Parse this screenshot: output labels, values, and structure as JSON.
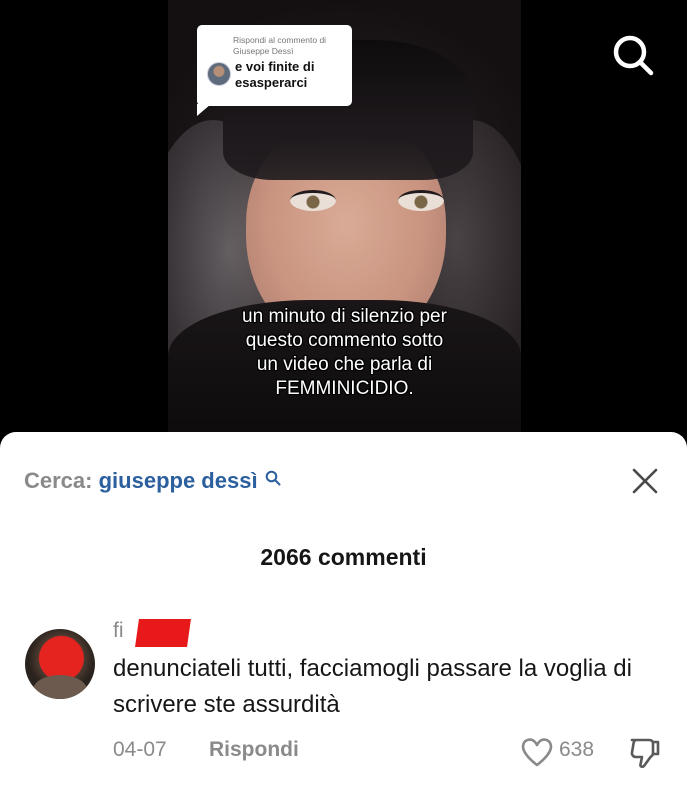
{
  "video": {
    "reply_card": {
      "subtitle": "Rispondi al commento di\nGiuseppe Dessì",
      "text": "e voi finite di\nesasperarci"
    },
    "caption": "un minuto di silenzio per\nquesto commento sotto\nun video che parla di\nFEMMINICIDIO.",
    "search_icon": "search-icon"
  },
  "comments_sheet": {
    "search_label": "Cerca:",
    "search_term": "giuseppe dessì",
    "count_label": "2066 commenti",
    "close_icon": "close-icon",
    "comment": {
      "username_visible": "fi",
      "text": "denunciateli tutti, facciamogli passare la voglia di scrivere ste assurdità",
      "date": "04-07",
      "reply_label": "Rispondi",
      "likes": "638"
    }
  },
  "colors": {
    "link_blue": "#2b5f9e",
    "muted_gray": "#8a8a8a",
    "redaction_red": "#e8191b"
  }
}
